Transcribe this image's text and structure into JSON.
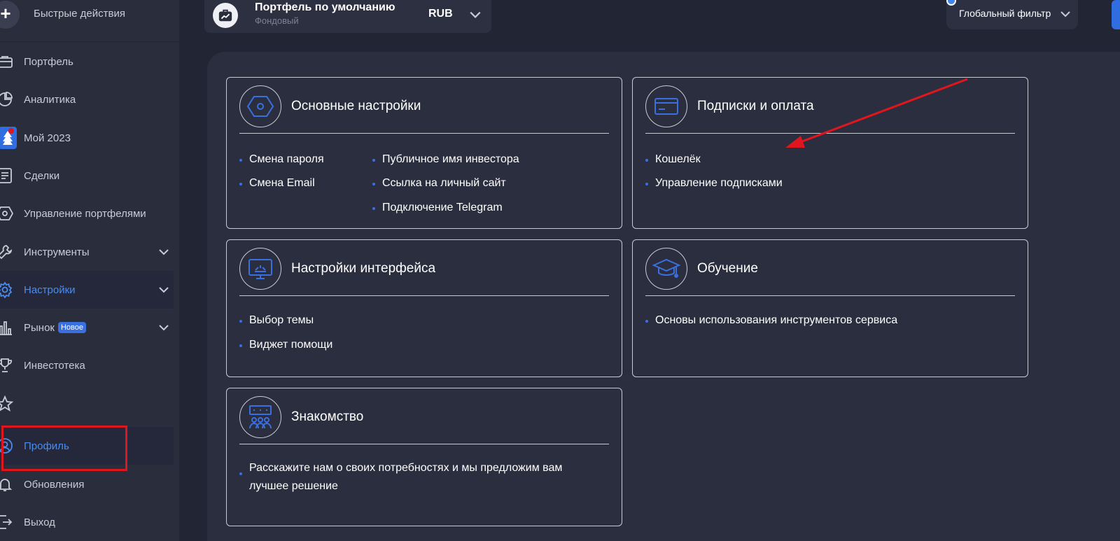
{
  "sidebar": {
    "quick_actions": "Быстрые действия",
    "items": [
      {
        "label": "Портфель",
        "icon": "briefcase-icon"
      },
      {
        "label": "Аналитика",
        "icon": "pie-chart-icon"
      },
      {
        "label": "Мой 2023",
        "icon": "new-year-tree-icon"
      },
      {
        "label": "Сделки",
        "icon": "list-icon"
      },
      {
        "label": "Управление портфелями",
        "icon": "hexagon-icon"
      },
      {
        "label": "Инструменты",
        "icon": "wrench-icon"
      },
      {
        "label": "Настройки",
        "icon": "gear-icon"
      },
      {
        "label": "Рынок",
        "icon": "bar-chart-icon",
        "badge": "Новое"
      },
      {
        "label": "Инвестотека",
        "icon": "trophy-icon"
      },
      {
        "label": "",
        "icon": "star-icon"
      },
      {
        "label": "Профиль",
        "icon": "user-icon"
      },
      {
        "label": "Обновления",
        "icon": "bell-icon"
      },
      {
        "label": "Выход",
        "icon": "logout-icon"
      }
    ]
  },
  "header": {
    "portfolio_title": "Портфель по умолчанию",
    "portfolio_subtitle": "Фондовый",
    "currency": "RUB",
    "global_filter": "Глобальный фильтр"
  },
  "cards": {
    "basic": {
      "title": "Основные настройки",
      "links": [
        "Смена пароля",
        "Смена Email",
        "Публичное имя инвестора",
        "Ссылка на личный сайт",
        "Подключение Telegram"
      ]
    },
    "subscriptions": {
      "title": "Подписки и оплата",
      "links": [
        "Кошелёк",
        "Управление подписками"
      ]
    },
    "interface": {
      "title": "Настройки интерфейса",
      "links": [
        "Выбор темы",
        "Виджет помощи"
      ]
    },
    "learning": {
      "title": "Обучение",
      "links": [
        "Основы использования инструментов сервиса"
      ]
    },
    "acquaintance": {
      "title": "Знакомство",
      "links": [
        "Расскажите нам о своих потребностях и мы предложим вам лучшее решение"
      ]
    }
  },
  "colors": {
    "accent": "#3a6fe0",
    "highlight_red": "#e0161e"
  }
}
